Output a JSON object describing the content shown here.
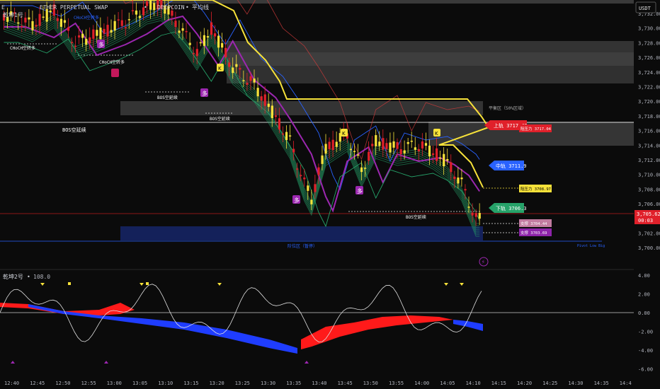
{
  "header": {
    "title_prefix": "E",
    "title": "ETHER PERPETUAL SWAP",
    "separator": "•",
    "exchange": "DEEPCOIN",
    "sep2": "•",
    "indicator_name": "平均线",
    "sub": "乾坤1号"
  },
  "currency_button": "USDT",
  "price_axis": {
    "ticks": [
      "3,732.00",
      "3,730.00",
      "3,728.00",
      "3,726.00",
      "3,724.00",
      "3,722.00",
      "3,720.00",
      "3,718.00",
      "3,716.00",
      "3,714.00",
      "3,712.00",
      "3,710.00",
      "3,708.00",
      "3,706.00",
      "3,704.00",
      "3,702.00",
      "3,700.00"
    ],
    "current_price": "3,705.62",
    "countdown": "00:03",
    "prev_price": "3,706.00"
  },
  "osc_axis": {
    "ticks": [
      "4.00",
      "2.00",
      "0.00",
      "-2.00",
      "-4.00",
      "-6.00"
    ]
  },
  "time_axis": {
    "ticks": [
      "12:40",
      "12:45",
      "12:50",
      "12:55",
      "13:00",
      "13:05",
      "13:10",
      "13:15",
      "13:20",
      "13:25",
      "13:30",
      "13:35",
      "13:40",
      "13:45",
      "13:50",
      "13:55",
      "14:00",
      "14:05",
      "14:10",
      "14:15",
      "14:20",
      "14:25",
      "14:30",
      "14:35",
      "14:4"
    ]
  },
  "annotations": {
    "choch1": "CHoCH空转多",
    "choch2": "CHoCH空转多",
    "choch_top": "CHoCH空转多",
    "bos1": "BOS空延续",
    "bos2": "BOS空延续",
    "bos3": "BOS空延续",
    "bos_main": "BOS空延续",
    "bos4": "BOS空延续",
    "balance": "平衡区（50%区域）",
    "bottom_zone": "阶位区（暂停）",
    "bottom_right": "Pivot Low Big",
    "duo": "多",
    "yellow_k": "K"
  },
  "tags": {
    "upper_rail": "上轨 3717.49",
    "resist1": "阻压力 3717.04",
    "mid_rail": "中轨 3711.9",
    "resist2": "阻压力 3708.97",
    "lower_rail": "下轨 3706.3",
    "support1": "支撑 3704.44",
    "support2": "支撑 3703.69"
  },
  "oscillator": {
    "name": "乾坤2号",
    "sep": "•",
    "value": "108.0"
  },
  "colors": {
    "bg": "#0b0b0b",
    "up": "#f7e23a",
    "down": "#e0202a",
    "ribbon_green": "#26a269",
    "purple": "#9c27b0",
    "blue": "#2962ff",
    "osc_red": "#ff1a1a",
    "osc_blue": "#1f3dff",
    "grid": "#1e1e1e"
  }
}
